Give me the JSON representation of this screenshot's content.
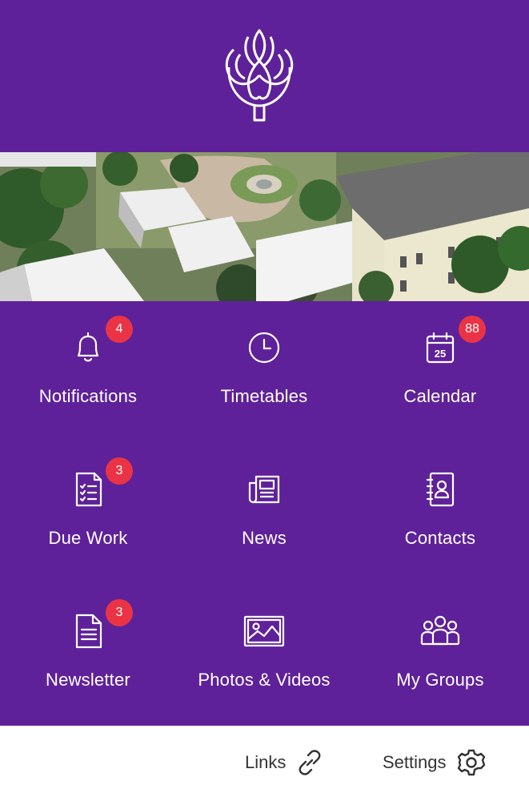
{
  "brand": {
    "primary": "#5f2199",
    "badge": "#ea3446",
    "logo_icon": "iris-flower-logo"
  },
  "tiles": [
    {
      "label": "Notifications",
      "icon": "bell-icon",
      "badge": "4"
    },
    {
      "label": "Timetables",
      "icon": "clock-icon",
      "badge": null
    },
    {
      "label": "Calendar",
      "icon": "calendar-icon",
      "badge": "88",
      "calendar_day": "25"
    },
    {
      "label": "Due Work",
      "icon": "checklist-icon",
      "badge": "3"
    },
    {
      "label": "News",
      "icon": "newspaper-icon",
      "badge": null
    },
    {
      "label": "Contacts",
      "icon": "contact-book-icon",
      "badge": null
    },
    {
      "label": "Newsletter",
      "icon": "document-icon",
      "badge": "3"
    },
    {
      "label": "Photos & Videos",
      "icon": "image-icon",
      "badge": null
    },
    {
      "label": "My Groups",
      "icon": "group-icon",
      "badge": null
    }
  ],
  "footer": {
    "links_label": "Links",
    "settings_label": "Settings"
  }
}
